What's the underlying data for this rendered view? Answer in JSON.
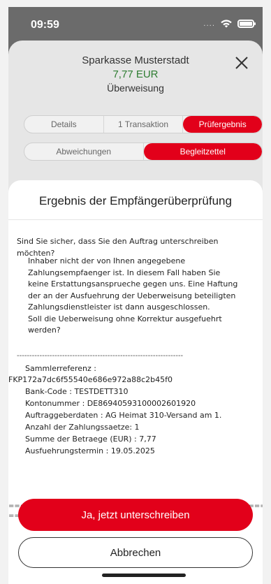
{
  "status": {
    "time": "09:59",
    "signal": "....",
    "icons": [
      "wifi-icon",
      "battery-icon"
    ]
  },
  "header": {
    "bank": "Sparkasse Musterstadt",
    "amount": "7,77 EUR",
    "type": "Überweisung",
    "close_icon": "close-icon"
  },
  "tabs1": [
    {
      "label": "Details",
      "active": false
    },
    {
      "label": "1 Transaktion",
      "active": false
    },
    {
      "label": "Prüfergebnis",
      "active": true
    }
  ],
  "tabs2": [
    {
      "label": "Abweichungen",
      "active": false
    },
    {
      "label": "Begleitzettel",
      "active": true
    }
  ],
  "card": {
    "title": "Ergebnis der Empfängerüberprüfung",
    "question": "Sind Sie sicher, dass Sie den Auftrag unterschreiben möchten?",
    "paragraph": [
      "Inhaber nicht der von Ihnen angegebene",
      "Zahlungsempfaenger ist. In diesem Fall haben Sie",
      "keine Erstattungsansprueche gegen uns. Eine Haftung",
      "der an der Ausfuehrung der Ueberweisung beteiligten",
      "Zahlungsdienstleister ist dann ausgeschlossen.",
      "Soll die Ueberweisung ohne Korrektur ausgefuehrt",
      "werden?"
    ],
    "dashes": "------------------------------------------------------------------",
    "sammlerreferenz_label": "Sammlerreferenz      :",
    "sammlerreferenz_value": "FKP172a7dc6f55540e686e972a88c2b45f0",
    "rows": [
      "Bank-Code          : TESTDETT310",
      "Kontonummer        : DE86940593100002601920",
      "Auftraggeberdaten    : AG Heimat 310-Versand am 1.",
      "Anzahl der Zahlungssaetze: 1",
      "Summe der Betraege (EUR) : 7,77",
      "Ausfuehrungstermin    : 19.05.2025"
    ],
    "equals_line1": "====================================================",
    "equals_line2": "======="
  },
  "buttons": {
    "confirm": "Ja, jetzt unterschreiben",
    "cancel": "Abbrechen"
  },
  "colors": {
    "accent": "#e2001a",
    "amount": "#2e7d32"
  }
}
